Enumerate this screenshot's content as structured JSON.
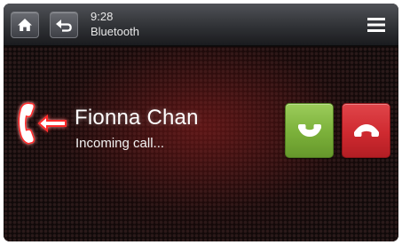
{
  "status_bar": {
    "time": "9:28",
    "source": "Bluetooth",
    "home_icon": "home-icon",
    "back_icon": "back-arrow-icon",
    "menu_icon": "menu-icon"
  },
  "call": {
    "caller_name": "Fionna Chan",
    "status": "Incoming call...",
    "direction_icon": "incoming-call-icon"
  },
  "actions": {
    "answer_icon": "phone-answer-icon",
    "answer_color": "#7bb03a",
    "decline_icon": "phone-hangup-icon",
    "decline_color": "#cf2a30"
  },
  "theme": {
    "accent": "#c8262c",
    "background": "#100909"
  }
}
